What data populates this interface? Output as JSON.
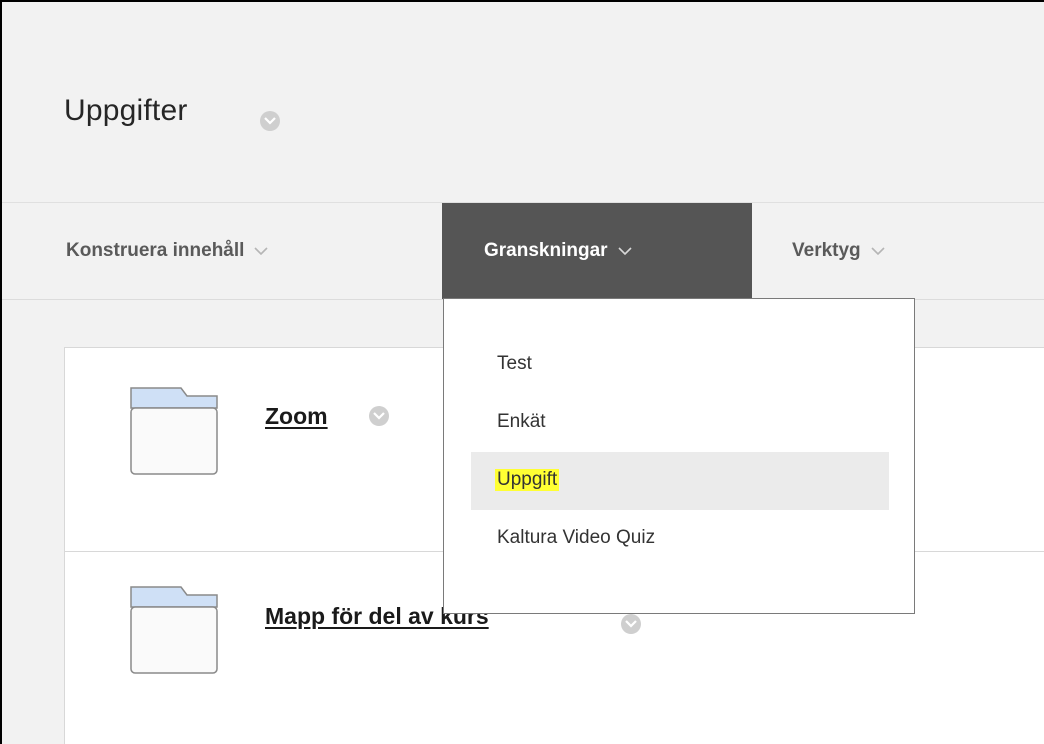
{
  "page": {
    "title": "Uppgifter"
  },
  "menubar": {
    "items": [
      {
        "label": "Konstruera innehåll",
        "active": false
      },
      {
        "label": "Granskningar",
        "active": true
      },
      {
        "label": "Verktyg",
        "active": false
      }
    ]
  },
  "dropdown": {
    "items": [
      {
        "label": "Test",
        "hovered": false
      },
      {
        "label": "Enkät",
        "hovered": false
      },
      {
        "label": "Uppgift",
        "hovered": true,
        "highlight": "#ffff33"
      },
      {
        "label": "Kaltura Video Quiz",
        "hovered": false
      }
    ]
  },
  "content": {
    "items": [
      {
        "title": "Zoom",
        "icon": "folder-icon"
      },
      {
        "title": "Mapp för del av kurs",
        "icon": "folder-icon"
      }
    ]
  },
  "colors": {
    "background": "#f2f2f2",
    "active_menu_bg": "#555555",
    "highlight": "#ffff33"
  }
}
